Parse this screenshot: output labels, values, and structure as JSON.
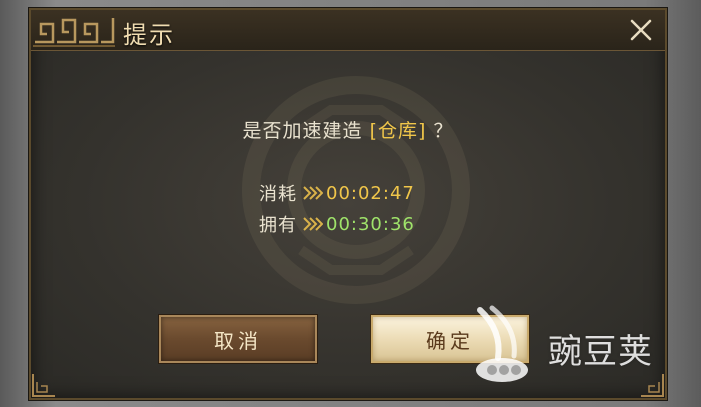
{
  "dialog": {
    "title": "提示",
    "question_prefix": "是否加速建造",
    "building_name": "[仓库]",
    "question_suffix": "？",
    "cost_label": "消耗",
    "cost_value": "00:02:47",
    "owned_label": "拥有",
    "owned_value": "00:30:36"
  },
  "buttons": {
    "cancel_label": "取消",
    "confirm_label": "确定"
  },
  "watermark": {
    "text": "豌豆荚"
  },
  "icons": {
    "close": "close-icon",
    "speedup": "speedup-icon",
    "ornament": "title-ornament-icon"
  },
  "colors": {
    "highlight": "#f0c64a",
    "owned": "#9fe36a",
    "text": "#e9e2cf",
    "title": "#f1ddb1"
  }
}
